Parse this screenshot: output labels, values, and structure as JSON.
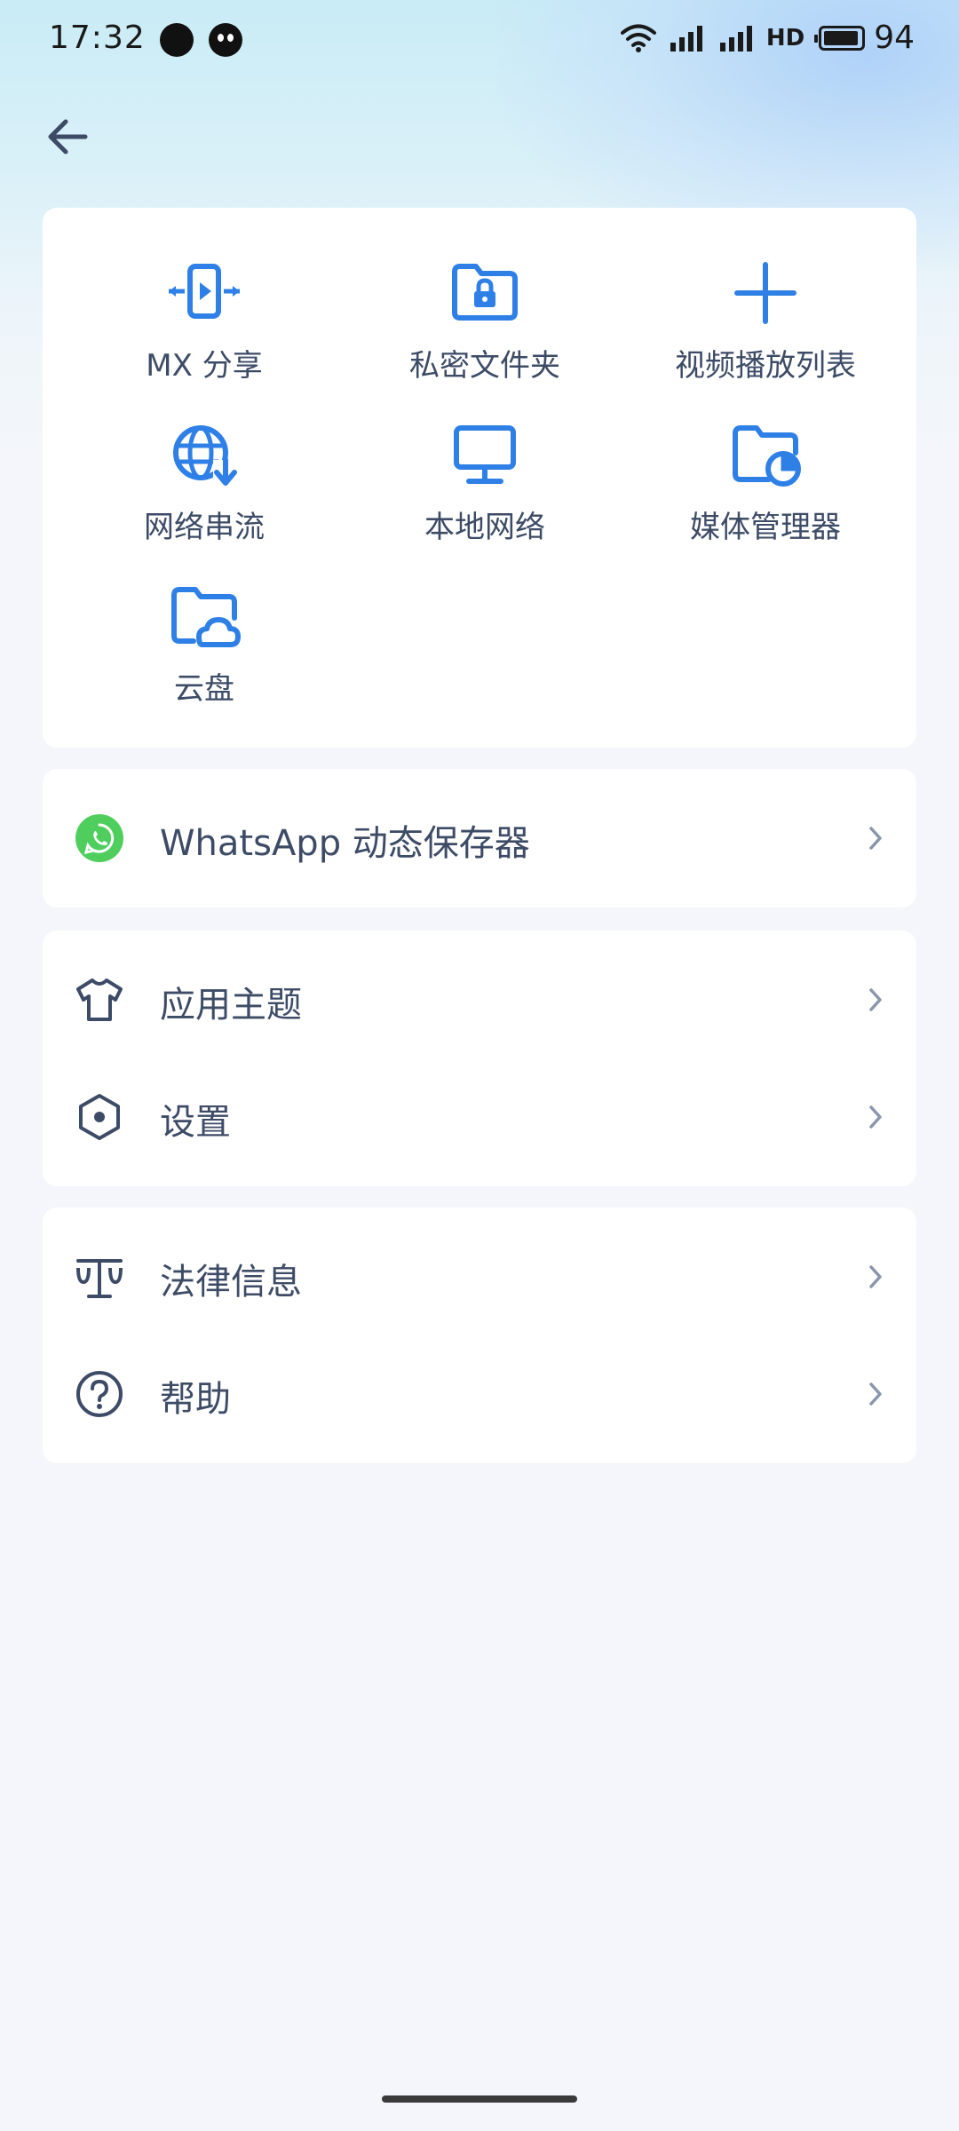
{
  "status_bar": {
    "time": "17:32",
    "network_label": "HD",
    "battery_level": "94"
  },
  "grid": {
    "items": [
      {
        "label": "MX 分享",
        "icon": "mx-share-icon"
      },
      {
        "label": "私密文件夹",
        "icon": "private-folder-icon"
      },
      {
        "label": "视频播放列表",
        "icon": "plus-icon"
      },
      {
        "label": "网络串流",
        "icon": "network-stream-icon"
      },
      {
        "label": "本地网络",
        "icon": "monitor-icon"
      },
      {
        "label": "媒体管理器",
        "icon": "media-manager-icon"
      },
      {
        "label": "云盘",
        "icon": "cloud-folder-icon"
      }
    ]
  },
  "whatsapp": {
    "label": "WhatsApp 动态保存器",
    "icon": "whatsapp-icon"
  },
  "theme_group": {
    "items": [
      {
        "label": "应用主题",
        "icon": "tshirt-icon"
      },
      {
        "label": "设置",
        "icon": "settings-hexagon-icon"
      }
    ]
  },
  "legal_group": {
    "items": [
      {
        "label": "法律信息",
        "icon": "scale-icon"
      },
      {
        "label": "帮助",
        "icon": "help-icon"
      }
    ]
  },
  "colors": {
    "accent": "#2f80e6",
    "text": "#3d4b66",
    "whatsapp": "#4fce5d",
    "background": "#f4f6fb"
  }
}
